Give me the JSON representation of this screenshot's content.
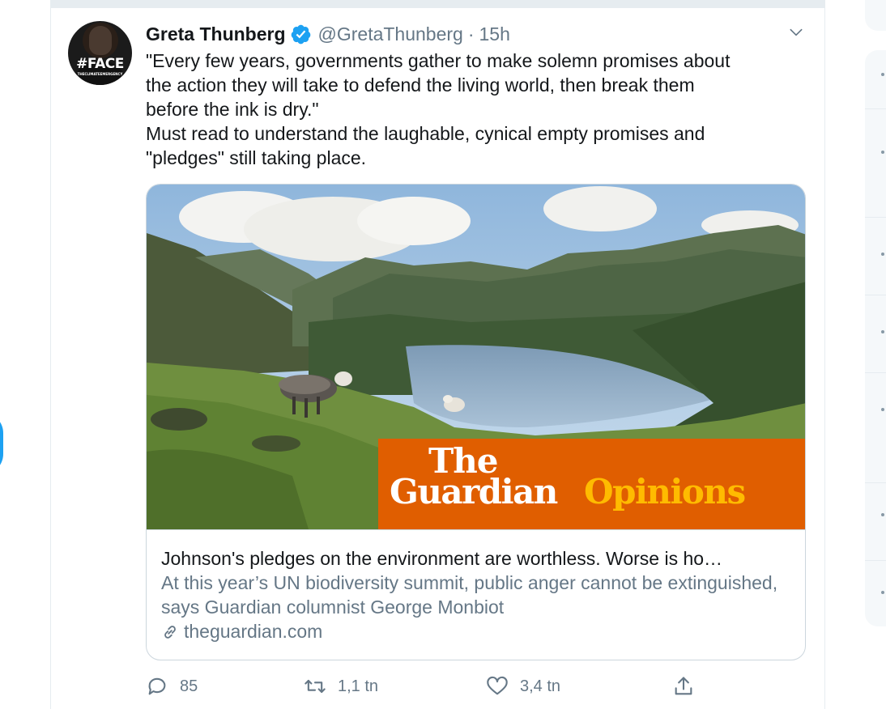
{
  "tweet": {
    "author_name": "Greta Thunberg",
    "handle": "@GretaThunberg",
    "separator": "·",
    "time": "15h",
    "avatar": {
      "tag": "#FACE",
      "sub": "THECLIMATEEMERGENCY"
    },
    "text_lines": [
      "\"Every few years, governments gather to make solemn promises about",
      "the action they will take to defend the living world, then break them",
      "before the ink is dry.\"",
      "Must read to understand the laughable, cynical empty promises and",
      "\"pledges\" still taking place."
    ],
    "card": {
      "brand_line1": "The",
      "brand_line2": "Guardian",
      "brand_section": "Opinions",
      "title": "Johnson's pledges on the environment are worthless. Worse is ho…",
      "description": "At this year’s UN biodiversity summit, public anger cannot be extinguished, says Guardian columnist George Monbiot",
      "domain": "theguardian.com"
    },
    "actions": {
      "replies": "85",
      "retweets": "1,1 tn",
      "likes": "3,4 tn"
    }
  },
  "colors": {
    "accent": "#1da1f2",
    "secondary_text": "#657786",
    "border": "#ccd6dd",
    "guardian_orange": "#e05e00",
    "guardian_yellow": "#ffbb00"
  },
  "icons": [
    "verified-badge-icon",
    "chevron-down-icon",
    "link-icon",
    "reply-icon",
    "retweet-icon",
    "like-icon",
    "share-icon"
  ]
}
